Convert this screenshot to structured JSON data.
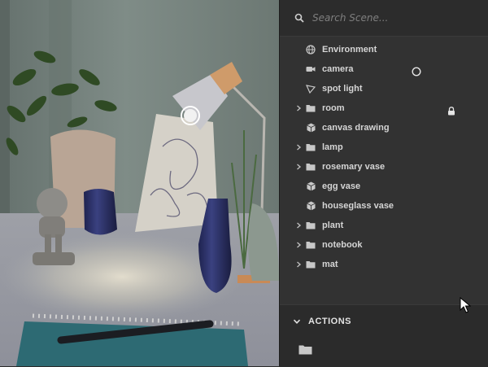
{
  "search": {
    "placeholder": "Search Scene..."
  },
  "scene_tree": [
    {
      "label": "Environment",
      "icon": "globe-icon",
      "expandable": false
    },
    {
      "label": "camera",
      "icon": "camera-icon",
      "expandable": false,
      "extra": "circle-indicator-icon"
    },
    {
      "label": "spot light",
      "icon": "spotlight-icon",
      "expandable": false
    },
    {
      "label": "room",
      "icon": "folder-icon",
      "expandable": true,
      "extra": "lock-icon"
    },
    {
      "label": "canvas drawing",
      "icon": "cube-icon",
      "expandable": false
    },
    {
      "label": "lamp",
      "icon": "folder-icon",
      "expandable": true
    },
    {
      "label": "rosemary vase",
      "icon": "folder-icon",
      "expandable": true
    },
    {
      "label": "egg vase",
      "icon": "cube-icon",
      "expandable": false
    },
    {
      "label": "houseglass vase",
      "icon": "cube-icon",
      "expandable": false
    },
    {
      "label": "plant",
      "icon": "folder-icon",
      "expandable": true
    },
    {
      "label": "notebook",
      "icon": "folder-icon",
      "expandable": true
    },
    {
      "label": "mat",
      "icon": "folder-icon",
      "expandable": true
    }
  ],
  "actions": {
    "title": "ACTIONS",
    "icon": "folder-icon"
  },
  "colors": {
    "panel": "#323232",
    "text": "#d5d5d5",
    "icon": "#c8c8c8"
  }
}
